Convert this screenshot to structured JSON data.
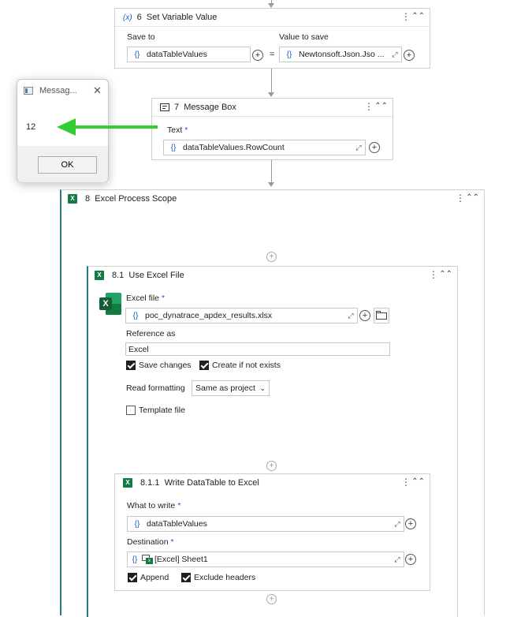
{
  "connector_top": "",
  "activity6": {
    "number": "6",
    "title": "Set Variable Value",
    "save_to_label": "Save to",
    "value_to_save_label": "Value to save",
    "save_to_value": "dataTableValues",
    "equals": "=",
    "value_to_save_value": "Newtonsoft.Json.Jso ...",
    "brace": "{}"
  },
  "activity7": {
    "number": "7",
    "title": "Message Box",
    "text_label": "Text",
    "required": "*",
    "text_value": "dataTableValues.RowCount",
    "brace": "{}"
  },
  "message_dialog": {
    "title": "Messag...",
    "close": "✕",
    "content": "12",
    "ok_label": "OK"
  },
  "activity8": {
    "number": "8",
    "title": "Excel Process Scope"
  },
  "activity8_1": {
    "number": "8.1",
    "title": "Use Excel File",
    "excel_file_label": "Excel file",
    "required": "*",
    "excel_file_value": "poc_dynatrace_apdex_results.xlsx",
    "brace": "{}",
    "reference_as_label": "Reference as",
    "reference_as_value": "Excel",
    "save_changes_label": "Save changes",
    "save_changes_checked": true,
    "create_if_not_exists_label": "Create if not exists",
    "create_if_not_exists_checked": true,
    "read_formatting_label": "Read formatting",
    "read_formatting_value": "Same as project",
    "template_file_label": "Template file",
    "template_file_checked": false
  },
  "activity8_1_1": {
    "number": "8.1.1",
    "title": "Write DataTable to Excel",
    "what_to_write_label": "What to write",
    "required": "*",
    "what_to_write_value": "dataTableValues",
    "destination_label": "Destination",
    "destination_value": "[Excel] Sheet1",
    "brace": "{}",
    "append_label": "Append",
    "append_checked": true,
    "exclude_headers_label": "Exclude headers",
    "exclude_headers_checked": true
  },
  "colors": {
    "accent": "#1660c4",
    "excel_green": "#107c41",
    "annotation_arrow": "#33cc33",
    "scope_border": "#2a7a7a"
  },
  "icons": {
    "variable": "variable-icon",
    "message_box": "message-box-icon",
    "excel": "excel-icon",
    "plus": "plus-circle-icon",
    "expand": "expand-icon",
    "folder": "folder-icon",
    "kebab": "kebab-icon",
    "collapse": "collapse-icon"
  }
}
